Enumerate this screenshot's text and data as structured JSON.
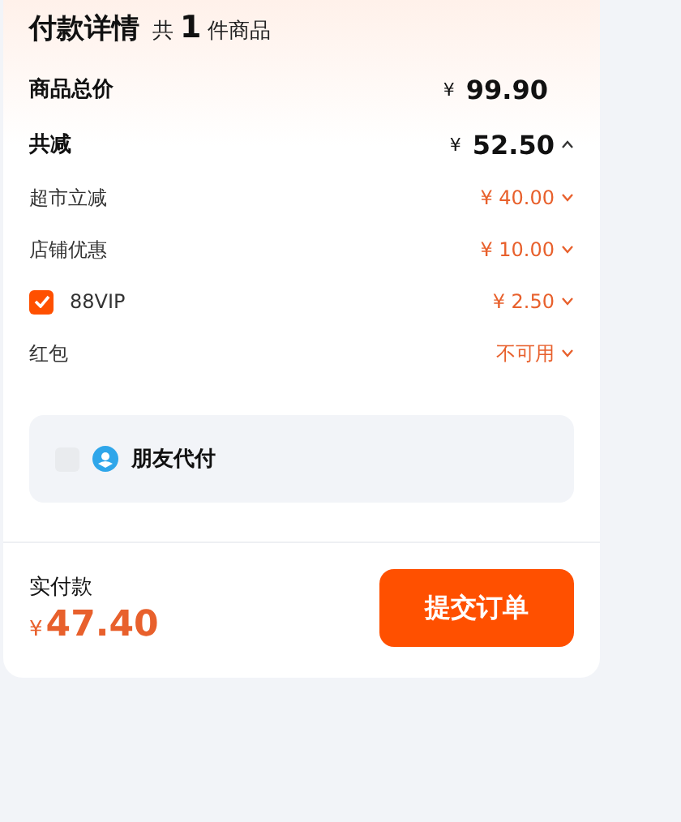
{
  "header": {
    "title": "付款详情",
    "count_prefix": "共",
    "count": "1",
    "count_suffix": "件商品"
  },
  "total": {
    "label": "商品总价",
    "currency": "¥",
    "amount": "99.90"
  },
  "discount": {
    "label": "共减",
    "currency": "¥",
    "amount": "52.50",
    "expanded": true,
    "items": [
      {
        "kind": "plain",
        "label": "超市立减",
        "value": "¥ 40.00",
        "expanded": false
      },
      {
        "kind": "plain",
        "label": "店铺优惠",
        "value": "¥ 10.00",
        "expanded": false
      },
      {
        "kind": "checkbox",
        "label": "88VIP",
        "value": "¥ 2.50",
        "checked": true,
        "expanded": false
      },
      {
        "kind": "plain",
        "label": "红包",
        "value": "不可用",
        "expanded": false
      }
    ]
  },
  "friend_pay": {
    "label": "朋友代付",
    "checked": false
  },
  "footer": {
    "label": "实付款",
    "currency": "¥",
    "amount": "47.40",
    "button": "提交订单"
  }
}
